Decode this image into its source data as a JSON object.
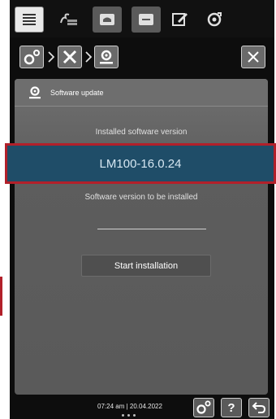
{
  "tabs": [
    {
      "icon": "menu-list-icon",
      "active": true
    },
    {
      "icon": "steam-cooking-icon",
      "active": false
    },
    {
      "icon": "chef-hat-icon",
      "active": false
    },
    {
      "icon": "tray-icon",
      "active": false
    },
    {
      "icon": "edit-note-icon",
      "active": false
    },
    {
      "icon": "settings-cycle-icon",
      "active": false
    }
  ],
  "breadcrumb": {
    "items": [
      "gears-icon",
      "tools-icon",
      "software-update-icon"
    ]
  },
  "panel": {
    "title": "Software update",
    "installed_label": "Installed software version",
    "installed_version": "LM100-16.0.24",
    "to_install_label": "Software version to be installed",
    "to_install_value": "",
    "start_button": "Start installation"
  },
  "status": {
    "time": "07:24 am",
    "separator": "|",
    "date": "20.04.2022"
  },
  "bottom_buttons": {
    "help_label": "?"
  },
  "colors": {
    "version_bar": "#1f4d68",
    "highlight_border": "#b2202a"
  }
}
